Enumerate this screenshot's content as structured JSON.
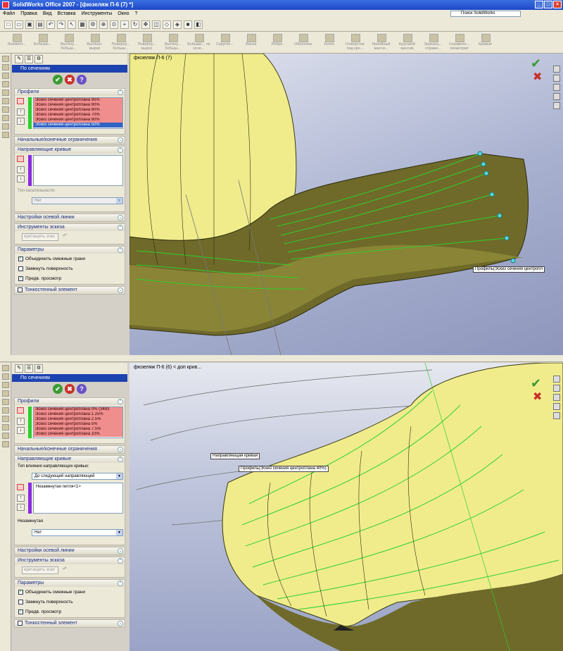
{
  "window": {
    "title": "SolidWorks Office 2007 - [фюзеляж П-6 (7) *]",
    "buttons": [
      "_",
      "□",
      "×"
    ]
  },
  "menu": {
    "items": [
      "Файл",
      "Правка",
      "Вид",
      "Вставка",
      "Инструменты",
      "Окно",
      "?"
    ]
  },
  "search": {
    "placeholder": "Поиск SolidWorks"
  },
  "features_toolbar": {
    "buttons": [
      "Элемент...",
      "Бобышк...",
      "Вытяну... бобыш...",
      "Вытянут. вырез",
      "Поверну... бобыш...",
      "Поверну... вырез",
      "Вытяну... бобыш...",
      "Бобышк... по сече...",
      "Скругле...",
      "Фаска",
      "Ребро",
      "Оболочка",
      "Уклон",
      "Отверстие под кре...",
      "Линейный масси...",
      "Круговой массив",
      "Зеркаль... отраже...",
      "Справочн... геометрия",
      "Кривые"
    ]
  },
  "top": {
    "tabs": [
      "✎",
      "☰",
      "⚙"
    ],
    "header": "По сечениям",
    "ok_buttons": [
      "✔",
      "✖",
      "?"
    ],
    "groups": {
      "profiles": {
        "title": "Профили",
        "items": [
          "Эскиз сечения центроплана 95%",
          "Эскиз сечения центроплана 90%",
          "Эскиз сечения центроплана 80%",
          "Эскиз сечения центроплана 70%",
          "Эскиз сечения центроплана 60%",
          "Эскиз сечения центроплана 50%"
        ],
        "selected_index": 5
      },
      "start_end": "Начальные/конечные ограничения",
      "guides": {
        "title": "Направляющие кривые",
        "tangency_label": "Тип касательности:",
        "tangency_value": "Нет"
      },
      "centerline": "Настройки осевой линии",
      "sketch_tools": {
        "title": "Инструменты эскиза",
        "drag_button": "еретащить эски",
        "undo": "↶"
      },
      "options": {
        "title": "Параметры",
        "checks": [
          {
            "label": "Объединить смежные грани",
            "checked": true
          },
          {
            "label": "Замкнуть поверхность",
            "checked": false
          },
          {
            "label": "Предв. просмотр",
            "checked": true
          }
        ]
      },
      "thin": "Тонкостенный элемент"
    },
    "view": {
      "title": "фюзеляж П-6 (7)",
      "tooltip": "Профиль(Эскиз сечения центропл"
    }
  },
  "bottom": {
    "tabs": [
      "✎",
      "☰",
      "⚙"
    ],
    "header": "По сечениям",
    "ok_buttons": [
      "✔",
      "✖",
      "?"
    ],
    "groups": {
      "profiles": {
        "title": "Профили",
        "items": [
          "Эскиз сечения центроплана 0% (3483",
          "Эскиз сечения центроплана 1.25%",
          "Эскиз сечения центроплана 2.5%",
          "Эскиз сечения центроплана 5%",
          "Эскиз сечения центроплана 7.5%",
          "Эскиз сечения центроплана 10%"
        ]
      },
      "start_end": "Начальные/конечные ограничения",
      "guides": {
        "title": "Направляющие кривые",
        "influence_label": "Тип влияния направляющих кривых:",
        "influence_value": "До следующей направляющей",
        "item": "Незамкнутая петля<1>",
        "open_label": "Незамкнутая",
        "open_value": "Нет"
      },
      "centerline": "Настройки осевой линии",
      "sketch_tools": {
        "title": "Инструменты эскиза",
        "drag_button": "еретащить эски",
        "undo": "↶"
      },
      "options": {
        "title": "Параметры",
        "checks": [
          {
            "label": "Объединить смежные грани",
            "checked": true
          },
          {
            "label": "Замкнуть поверхность",
            "checked": false
          },
          {
            "label": "Предв. просмотр",
            "checked": true
          }
        ]
      },
      "thin": "Тонкостенный элемент"
    },
    "view": {
      "title": "фюзеляж П-6 (6) < доп крив...",
      "tooltip1": "Направляющая кривая",
      "tooltip2": "Профиль(Эскиз сечения центроплана 40%)"
    }
  },
  "colors": {
    "surface": "#f2ee8a",
    "surface_dark": "#6d6a28",
    "guide": "#2ecf2e",
    "bg_view": "#9aa3c6"
  }
}
